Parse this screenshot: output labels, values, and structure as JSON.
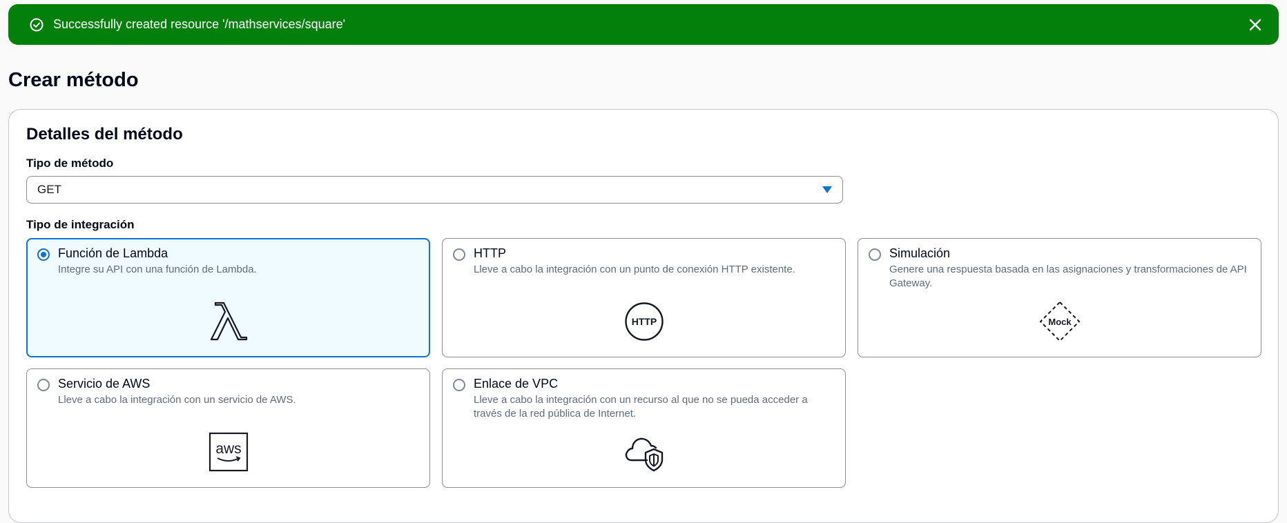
{
  "flash": {
    "message": "Successfully created resource '/mathservices/square'",
    "status_color": "#037f0c",
    "icons": [
      "check-circle-icon",
      "close-icon"
    ]
  },
  "page": {
    "title": "Crear método"
  },
  "details": {
    "title": "Detalles del método",
    "method_type_label": "Tipo de método",
    "method_type_value": "GET",
    "integration_type_label": "Tipo de integración",
    "accent_color": "#0972d3",
    "options": [
      {
        "title": "Función de Lambda",
        "description": "Integre su API con una función de Lambda.",
        "icon": "lambda-icon",
        "selected": true
      },
      {
        "title": "HTTP",
        "description": "Lleve a cabo la integración con un punto de conexión HTTP existente.",
        "icon": "http-icon",
        "icon_text": "HTTP",
        "selected": false
      },
      {
        "title": "Simulación",
        "description": "Genere una respuesta basada en las asignaciones y transformaciones de API Gateway.",
        "icon": "mock-icon",
        "icon_text": "Mock",
        "selected": false
      },
      {
        "title": "Servicio de AWS",
        "description": "Lleve a cabo la integración con un servicio de AWS.",
        "icon": "aws-icon",
        "icon_text": "aws",
        "selected": false
      },
      {
        "title": "Enlace de VPC",
        "description": "Lleve a cabo la integración con un recurso al que no se pueda acceder a través de la red pública de Internet.",
        "icon": "cloud-shield-icon",
        "selected": false
      }
    ]
  }
}
